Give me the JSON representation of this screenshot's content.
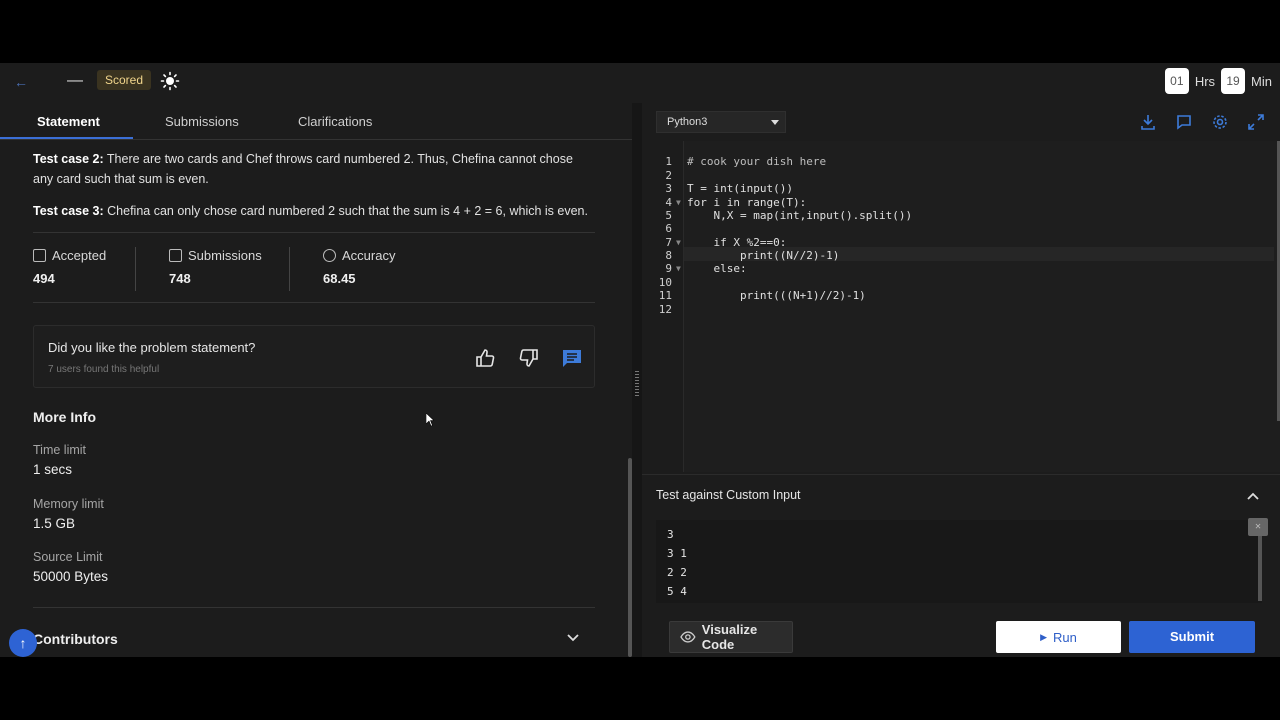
{
  "header": {
    "scored_label": "Scored",
    "timer": {
      "hours": "01",
      "hours_unit": "Hrs",
      "minutes": "19",
      "minutes_unit": "Min"
    }
  },
  "tabs": [
    "Statement",
    "Submissions",
    "Clarifications"
  ],
  "statement": {
    "case2_label": "Test case 2:",
    "case2_text": "There are two cards and Chef throws card numbered 2. Thus, Chefina cannot chose any card such that sum is even.",
    "case3_label": "Test case 3:",
    "case3_text": "Chefina can only chose card numbered 2 such that the sum is 4 + 2 = 6, which is even."
  },
  "stats": [
    {
      "label": "Accepted",
      "value": "494"
    },
    {
      "label": "Submissions",
      "value": "748"
    },
    {
      "label": "Accuracy",
      "value": "68.45"
    }
  ],
  "feedback": {
    "question": "Did you like the problem statement?",
    "helpful": "7 users found this helpful"
  },
  "more_info": {
    "title": "More Info",
    "items": [
      {
        "label": "Time limit",
        "value": "1 secs"
      },
      {
        "label": "Memory limit",
        "value": "1.5 GB"
      },
      {
        "label": "Source Limit",
        "value": "50000 Bytes"
      }
    ]
  },
  "contributors_label": "Contributors",
  "editor": {
    "language": "Python3",
    "lines": [
      "# cook your dish here",
      "",
      "T = int(input())",
      "for i in range(T):",
      "    N,X = map(int,input().split())",
      "",
      "    if X %2==0:",
      "        print((N//2)-1)",
      "    else:",
      "",
      "        print(((N+1)//2)-1)",
      ""
    ],
    "line_numbers": [
      "1",
      "2",
      "3",
      "4",
      "5",
      "6",
      "7",
      "8",
      "9",
      "10",
      "11",
      "12"
    ]
  },
  "custom_input": {
    "title": "Test against Custom Input",
    "lines": [
      "3",
      "3 1",
      "2 2",
      "5 4"
    ]
  },
  "actions": {
    "visualize": "Visualize Code",
    "run": "Run",
    "submit": "Submit"
  }
}
